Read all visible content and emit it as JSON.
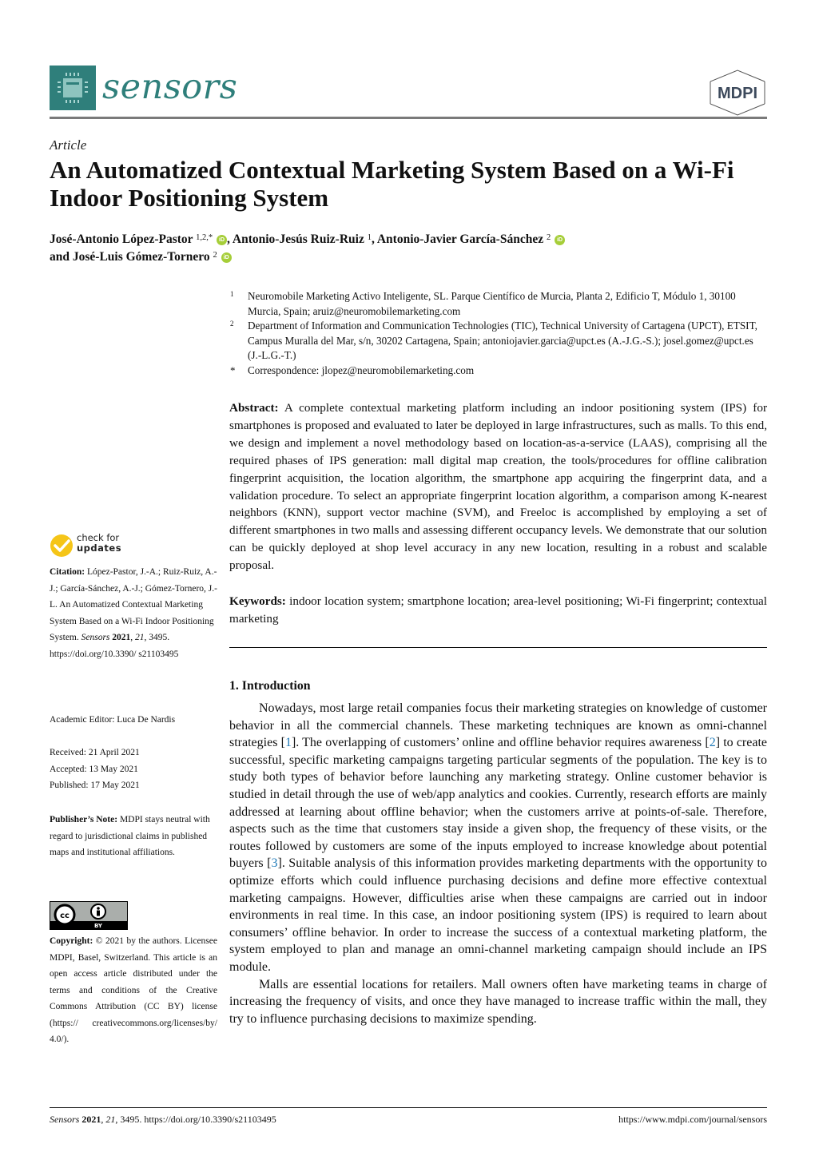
{
  "header": {
    "journal_name": "sensors",
    "publisher": "MDPI",
    "logo_color": "#2f7f7b"
  },
  "article": {
    "type": "Article",
    "title": "An Automatized Contextual Marketing System Based on a Wi-Fi Indoor Positioning System",
    "authors": [
      {
        "name": "José-Antonio López-Pastor",
        "affil": "1,2,*",
        "orcid": true,
        "sep": ", "
      },
      {
        "name": "Antonio-Jesús Ruiz-Ruiz",
        "affil": "1",
        "orcid": false,
        "sep": ", "
      },
      {
        "name": "Antonio-Javier García-Sánchez",
        "affil": "2",
        "orcid": true,
        "sep": ""
      },
      {
        "name": "and José-Luis Gómez-Tornero",
        "affil": "2",
        "orcid": true,
        "sep": ""
      }
    ],
    "orcid_label": "iD"
  },
  "affiliations": [
    {
      "mark": "1",
      "text": "Neuromobile Marketing Activo Inteligente, SL. Parque Científico de Murcia, Planta 2, Edificio T, Módulo 1, 30100 Murcia, Spain; aruiz@neuromobilemarketing.com"
    },
    {
      "mark": "2",
      "text": "Department of Information and Communication Technologies (TIC), Technical University of Cartagena (UPCT), ETSIT, Campus Muralla del Mar, s/n, 30202 Cartagena, Spain; antoniojavier.garcia@upct.es (A.-J.G.-S.); josel.gomez@upct.es (J.-L.G.-T.)"
    },
    {
      "mark": "*",
      "text": "Correspondence: jlopez@neuromobilemarketing.com"
    }
  ],
  "abstract": {
    "label": "Abstract:",
    "text": "A complete contextual marketing platform including an indoor positioning system (IPS) for smartphones is proposed and evaluated to later be deployed in large infrastructures, such as malls. To this end, we design and implement a novel methodology based on location-as-a-service (LAAS), comprising all the required phases of IPS generation: mall digital map creation, the tools/procedures for offline calibration fingerprint acquisition, the location algorithm, the smartphone app acquiring the fingerprint data, and a validation procedure. To select an appropriate fingerprint location algorithm, a comparison among K-nearest neighbors (KNN), support vector machine (SVM), and Freeloc is accomplished by employing a set of different smartphones in two malls and assessing different occupancy levels. We demonstrate that our solution can be quickly deployed at shop level accuracy in any new location, resulting in a robust and scalable proposal."
  },
  "keywords": {
    "label": "Keywords:",
    "text": "indoor location system; smartphone location; area-level positioning; Wi-Fi fingerprint; contextual marketing"
  },
  "introduction": {
    "heading": "1. Introduction",
    "p1": {
      "a": "Nowadays, most large retail companies focus their marketing strategies on knowledge of customer behavior in all the commercial channels. These marketing techniques are known as omni-channel strategies [",
      "r1": "1",
      "b": "]. The overlapping of customers’ online and offline behavior requires awareness [",
      "r2": "2",
      "c": "] to create successful, specific marketing campaigns targeting particular segments of the population. The key is to study both types of behavior before launching any marketing strategy. Online customer behavior is studied in detail through the use of web/app analytics and cookies. Currently, research efforts are mainly addressed at learning about offline behavior; when the customers arrive at points-of-sale. Therefore, aspects such as the time that customers stay inside a given shop, the frequency of these visits, or the routes followed by customers are some of the inputs employed to increase knowledge about potential buyers [",
      "r3": "3",
      "d": "]. Suitable analysis of this information provides marketing departments with the opportunity to optimize efforts which could influence purchasing decisions and define more effective contextual marketing campaigns. However, difficulties arise when these campaigns are carried out in indoor environments in real time. In this case, an indoor positioning system (IPS) is required to learn about consumers’ offline behavior. In order to increase the success of a contextual marketing platform, the system employed to plan and manage an omni-channel marketing campaign should include an IPS module."
    },
    "p2": "Malls are essential locations for retailers. Mall owners often have marketing teams in charge of increasing the frequency of visits, and once they have managed to increase traffic within the mall, they try to influence purchasing decisions to maximize spending."
  },
  "sidebar": {
    "check_updates": {
      "line1": "check for",
      "line2": "updates"
    },
    "citation": {
      "label": "Citation:",
      "authors": "López-Pastor, J.-A.; Ruiz-Ruiz, A.-J.; García-Sánchez, A.-J.; Gómez-Tornero, J.-L. An Automatized Contextual Marketing System Based on a Wi-Fi Indoor Positioning System.",
      "journal": "Sensors",
      "year": "2021",
      "volume": "21",
      "rest": ", 3495. https://doi.org/10.3390/ s21103495"
    },
    "academic_editor": "Academic Editor: Luca De Nardis",
    "dates": {
      "received": "Received: 21 April 2021",
      "accepted": "Accepted: 13 May 2021",
      "published": "Published: 17 May 2021"
    },
    "publishers_note": {
      "label": "Publisher’s Note:",
      "text": "MDPI stays neutral with regard to jurisdictional claims in published maps and institutional affiliations."
    },
    "license_badge": {
      "cc": "cc",
      "by": "BY"
    },
    "copyright": {
      "label": "Copyright:",
      "text": "© 2021 by the authors. Licensee MDPI, Basel, Switzerland. This article is an open access article distributed under the terms and conditions of the Creative Commons Attribution (CC BY) license (https:// creativecommons.org/licenses/by/ 4.0/)."
    }
  },
  "footer": {
    "journal": "Sensors",
    "year": "2021",
    "volume": "21",
    "rest": ", 3495. https://doi.org/10.3390/s21103495",
    "url": "https://www.mdpi.com/journal/sensors"
  }
}
